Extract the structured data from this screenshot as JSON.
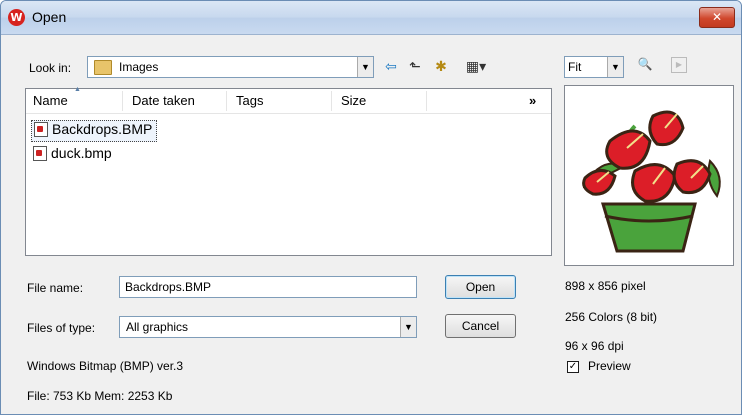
{
  "window": {
    "title": "Open",
    "app_icon": "W",
    "close_glyph": "✕"
  },
  "lookin": {
    "label": "Look in:",
    "value": "Images"
  },
  "toolbar": {
    "back_glyph": "⇦",
    "up_glyph": "⬑",
    "newfolder_glyph": "✱",
    "views_glyph": "▦▾"
  },
  "list": {
    "columns": [
      "Name",
      "Date taken",
      "Tags",
      "Size"
    ],
    "more_glyph": "»",
    "files": [
      "Backdrops.BMP",
      "duck.bmp"
    ]
  },
  "filename": {
    "label": "File name:",
    "value": "Backdrops.BMP"
  },
  "filetype": {
    "label": "Files of type:",
    "value": "All graphics"
  },
  "buttons": {
    "open": "Open",
    "cancel": "Cancel"
  },
  "info": {
    "format": "Windows Bitmap (BMP) ver.3",
    "size": "File: 753 Kb   Mem: 2253 Kb"
  },
  "zoom": {
    "value": "Fit"
  },
  "image_info": {
    "dimensions": "898 x 856 pixel",
    "colors": "256 Colors (8 bit)",
    "dpi": "96 x 96 dpi"
  },
  "preview_toggle": {
    "label": "Preview",
    "checked": true
  },
  "icons": {
    "preview_icon": "🔍",
    "next_icon": "▶"
  }
}
